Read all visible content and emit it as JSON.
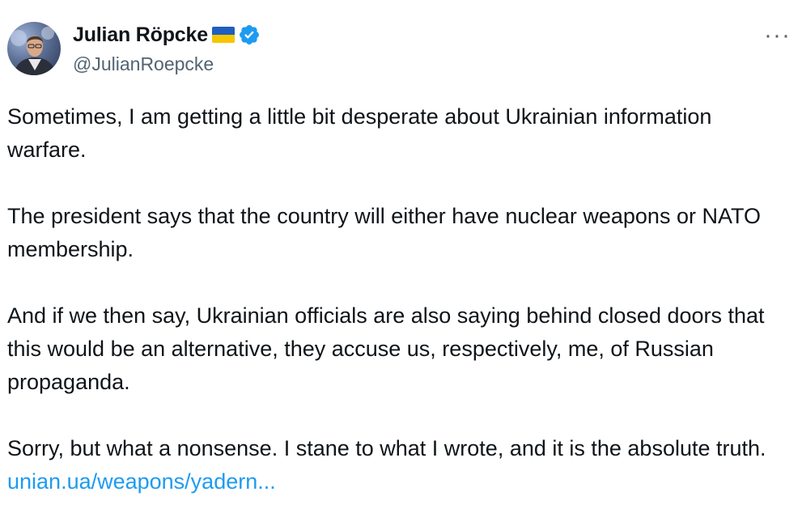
{
  "author": {
    "display_name": "Julian Röpcke",
    "handle": "@JulianRoepcke",
    "flag_colors": {
      "top": "#1f5fbf",
      "bottom": "#f7c600"
    },
    "verified_color": "#1d9bf0",
    "avatar_icon": "avatar-portrait"
  },
  "menu": {
    "more_label": "···"
  },
  "tweet": {
    "paragraphs": [
      "Sometimes, I am getting a little bit desperate about Ukrainian information warfare.",
      "The president says that the country will either have nuclear weapons or NATO membership.",
      "And if we then say, Ukrainian officials are also saying behind closed doors that this would be an alternative, they accuse us, respectively, me, of Russian propaganda.",
      "Sorry, but what a nonsense. I stane to what I wrote, and it is the absolute truth."
    ],
    "link": "unian.ua/weapons/yadern..."
  },
  "colors": {
    "text": "#0f1419",
    "secondary": "#536471",
    "link": "#1d9bf0"
  }
}
